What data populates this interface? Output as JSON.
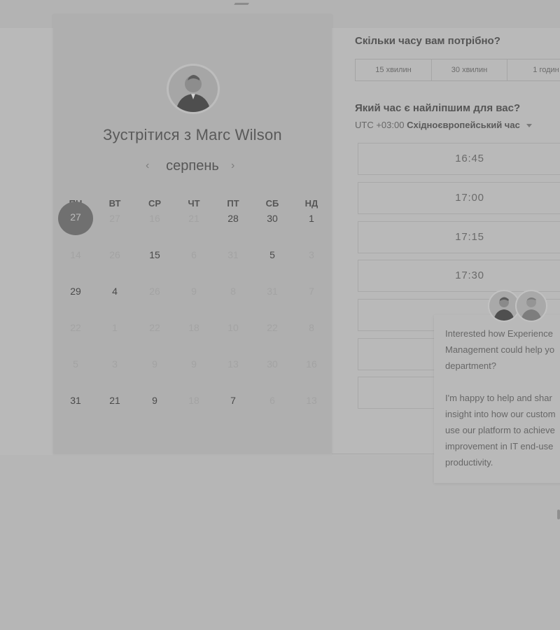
{
  "host": {
    "title": "Зустрітися з Marc Wilson",
    "avatar_icon": "host-avatar-photo"
  },
  "calendar": {
    "month": "серпень",
    "prev_icon": "chevron-left-icon",
    "next_icon": "chevron-right-icon",
    "weekdays": [
      "ПН",
      "ВТ",
      "СР",
      "ЧТ",
      "ПТ",
      "СБ",
      "НД"
    ],
    "weeks": [
      [
        "27",
        "27",
        "16",
        "21",
        "28",
        "30",
        "1"
      ],
      [
        "14",
        "26",
        "15",
        "6",
        "31",
        "5",
        "3"
      ],
      [
        "29",
        "4",
        "26",
        "9",
        "8",
        "31",
        "7"
      ],
      [
        "22",
        "1",
        "22",
        "18",
        "10",
        "22",
        "8"
      ],
      [
        "5",
        "3",
        "9",
        "9",
        "13",
        "30",
        "16"
      ],
      [
        "31",
        "21",
        "9",
        "18",
        "7",
        "6",
        "13"
      ]
    ],
    "states": [
      [
        "selected",
        "muted",
        "muted",
        "muted",
        "normal",
        "normal",
        "normal"
      ],
      [
        "muted",
        "muted",
        "normal",
        "muted",
        "muted",
        "normal",
        "muted"
      ],
      [
        "normal",
        "normal",
        "muted",
        "muted",
        "muted",
        "muted",
        "muted"
      ],
      [
        "muted",
        "muted",
        "muted",
        "muted",
        "muted",
        "muted",
        "muted"
      ],
      [
        "muted",
        "muted",
        "muted",
        "muted",
        "muted",
        "muted",
        "muted"
      ],
      [
        "normal",
        "normal",
        "normal",
        "muted",
        "normal",
        "muted",
        "muted"
      ]
    ]
  },
  "duration": {
    "question": "Скільки часу вам потрібно?",
    "options": [
      "15 хвилин",
      "30 хвилин",
      "1 годин"
    ]
  },
  "time": {
    "question": "Який час є найліпшим для вас?",
    "timezone_offset": "UTC +03:00",
    "timezone_name": "Східноєвропейський час",
    "slots": [
      "16:45",
      "17:00",
      "17:15",
      "17:30"
    ]
  },
  "chat": {
    "message": "Interested how Experience\nManagement could help yo\ndepartment?\n\nI'm happy to help and shar\ninsight into how our custom\nuse our platform to achieve\nimprovement in IT end-use\nproductivity."
  },
  "colors": {
    "selected_day": "#707070",
    "page_bg": "#b6b6b6",
    "panel_bg": "#afafaf"
  }
}
